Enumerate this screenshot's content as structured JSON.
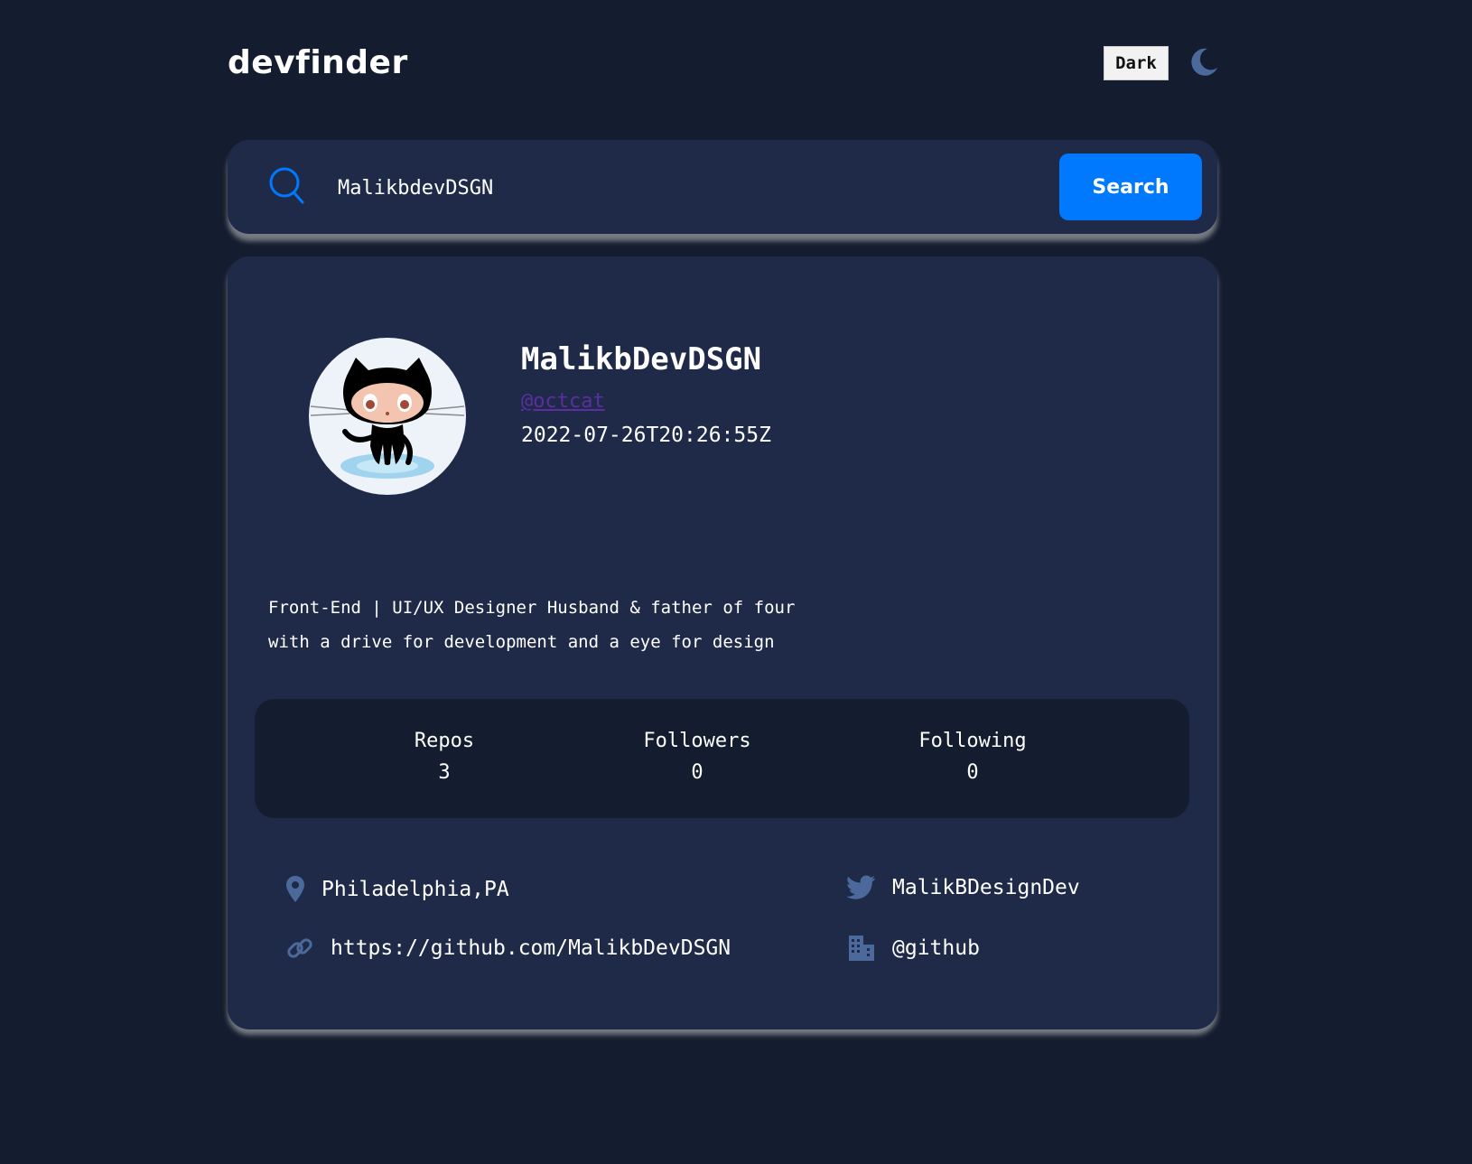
{
  "header": {
    "logo": "devfinder",
    "theme_label": "Dark",
    "theme_icon": "moon-icon"
  },
  "search": {
    "value": "MalikbdevDSGN",
    "button_label": "Search",
    "icon": "search-icon"
  },
  "profile": {
    "avatar_icon": "octocat-avatar",
    "name": "MalikbDevDSGN",
    "login": "@octcat",
    "created": "2022-07-26T20:26:55Z",
    "bio_line1": "Front-End | UI/UX Designer Husband & father of four",
    "bio_line2": "with a drive for development and a eye for design"
  },
  "stats": {
    "repos_label": "Repos",
    "repos_value": "3",
    "followers_label": "Followers",
    "followers_value": "0",
    "following_label": "Following",
    "following_value": "0"
  },
  "links": {
    "location": "Philadelphia,PA",
    "blog": "https://github.com/MalikbDevDSGN",
    "twitter": "MalikBDesignDev",
    "company": "@github"
  },
  "colors": {
    "background": "#141d2f",
    "card": "#1e2a47",
    "accent": "#0079ff",
    "icon": "#4b6a9b",
    "login_link": "#5c2ea0"
  }
}
